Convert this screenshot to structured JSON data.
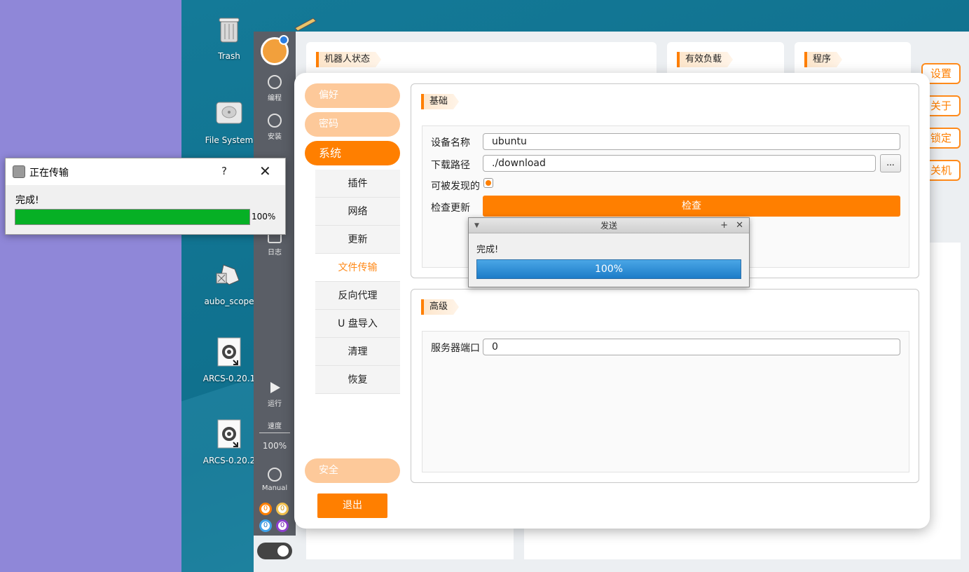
{
  "desktop": {
    "icons": [
      {
        "label": "Trash",
        "icon": "trash-icon"
      },
      {
        "label": "File System",
        "icon": "drive-icon"
      },
      {
        "label": "aubo_scope",
        "icon": "app-icon"
      },
      {
        "label": "ARCS-0.20.1",
        "icon": "gear-file-icon"
      },
      {
        "label": "ARCS-0.20.2",
        "icon": "gear-file-icon"
      }
    ]
  },
  "sidebar": {
    "items": [
      {
        "label": "编程",
        "icon": "program-icon"
      },
      {
        "label": "安装",
        "icon": "install-icon"
      },
      {
        "label": "日志",
        "icon": "log-icon"
      },
      {
        "label": "运行",
        "icon": "run-icon"
      }
    ],
    "speed_label": "速度",
    "speed_value": "100%",
    "mode_label": "Manual",
    "io_counts": [
      "0",
      "0",
      "0",
      "0"
    ]
  },
  "top_panels": {
    "robot_status": "机器人状态",
    "payload": "有效负载",
    "program": "程序"
  },
  "right_buttons": [
    "设置",
    "关于",
    "锁定",
    "关机"
  ],
  "settings": {
    "menu": [
      "偏好",
      "密码",
      "系统"
    ],
    "submenu": [
      "插件",
      "网络",
      "更新",
      "文件传输",
      "反向代理",
      "U 盘导入",
      "清理",
      "恢复"
    ],
    "active_submenu": "文件传输",
    "safety": "安全",
    "logout": "退出",
    "basic": {
      "title": "基础",
      "device_name_label": "设备名称",
      "device_name_value": "ubuntu",
      "download_path_label": "下载路径",
      "download_path_value": "./download",
      "browse_label": "...",
      "discoverable_label": "可被发现的",
      "check_update_label": "检查更新",
      "check_button": "检查"
    },
    "advanced": {
      "title": "高级",
      "server_port_label": "服务器端口",
      "server_port_value": "0"
    }
  },
  "send_dialog": {
    "title": "发送",
    "message": "完成!",
    "progress_text": "100%",
    "progress": 1.0
  },
  "transfer_window": {
    "title": "正在传输",
    "help": "?",
    "close": "✕",
    "message": "完成!",
    "progress_text": "100%",
    "progress": 1.0,
    "progress_color": "#06b025"
  }
}
